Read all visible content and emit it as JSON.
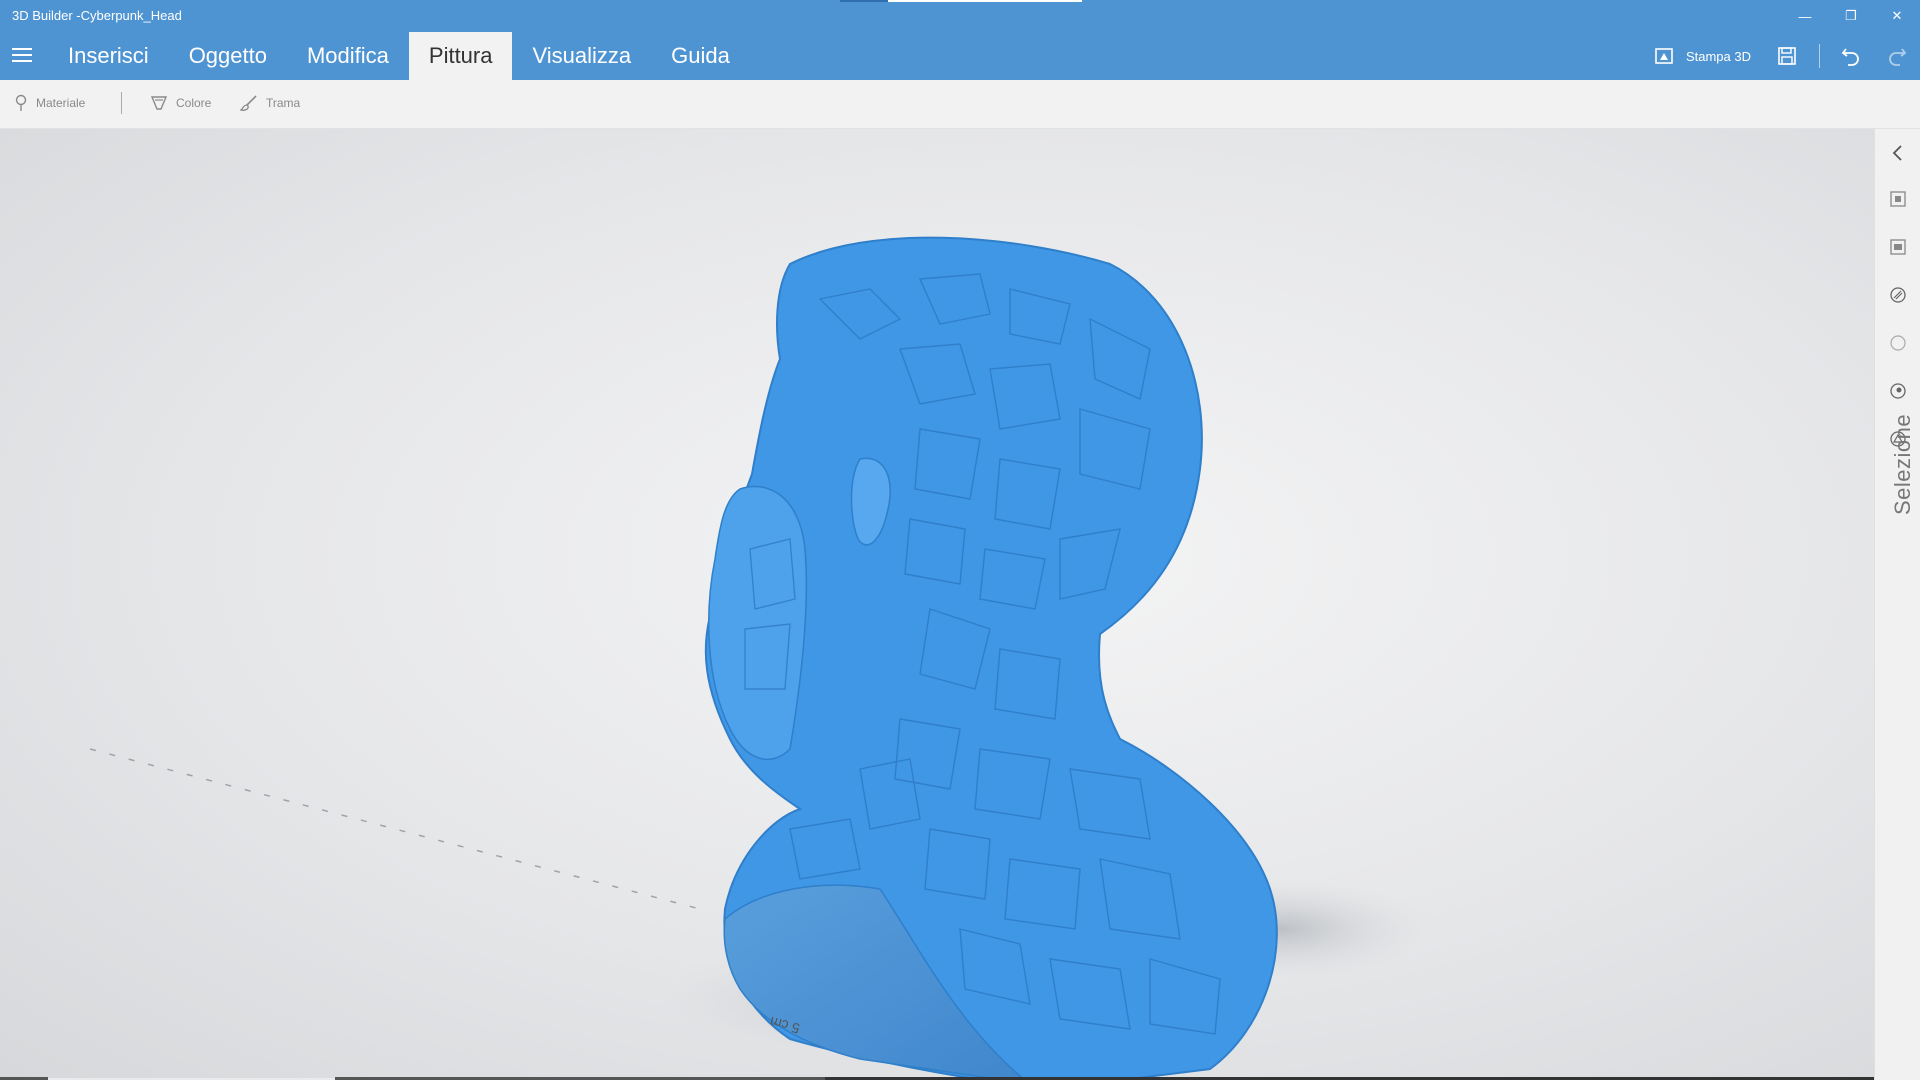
{
  "window": {
    "title": "3D Builder -Cyberpunk_Head",
    "minimize_glyph": "—",
    "restore_glyph": "❐",
    "close_glyph": "✕"
  },
  "tabs": [
    {
      "label": "Inserisci"
    },
    {
      "label": "Oggetto"
    },
    {
      "label": "Modifica"
    },
    {
      "label": "Pittura",
      "active": true
    },
    {
      "label": "Visualizza"
    },
    {
      "label": "Guida"
    }
  ],
  "header_tools": {
    "print_label": "Stampa 3D",
    "print_icon": "printer-3d-icon",
    "save_icon": "save-icon",
    "undo_icon": "undo-icon",
    "redo_icon": "redo-icon"
  },
  "toolbar": {
    "material_label": "Materiale",
    "color_label": "Colore",
    "texture_label": "Trama"
  },
  "viewport": {
    "scale_label": "5 cm",
    "model_color": "#3f97e6"
  },
  "side_panel": {
    "label": "Selezione",
    "icons": [
      "collapse-chevron-icon",
      "select-object-icon",
      "select-group-icon",
      "select-mesh-icon",
      "select-face-icon",
      "select-vertex-icon",
      "select-edge-icon"
    ]
  },
  "colors": {
    "accent": "#4f94d2",
    "ribbon_bg": "#f2f2f2"
  }
}
